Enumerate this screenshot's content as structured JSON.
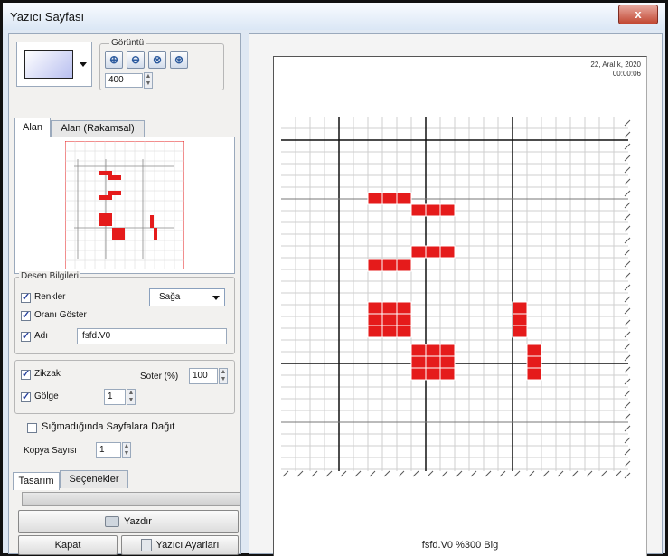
{
  "window": {
    "title": "Yazıcı Sayfası",
    "close_label": "x"
  },
  "view_group": {
    "label": "Görüntü",
    "zoom_value": "400"
  },
  "tabs_top": [
    "Alan",
    "Alan (Rakamsal)"
  ],
  "pattern_info": {
    "label": "Desen Bilgileri",
    "colors_label": "Renkler",
    "colors_checked": true,
    "direction_value": "Sağa",
    "ratio_label": "Oranı Göster",
    "ratio_checked": true,
    "name_label": "Adı",
    "name_checked": true,
    "name_value": "fsfd.V0"
  },
  "options": {
    "zigzag_label": "Zikzak",
    "zigzag_checked": true,
    "soter_label": "Soter (%)",
    "soter_value": "100",
    "shadow_label": "Gölge",
    "shadow_checked": true,
    "shadow_value": "1"
  },
  "fit_pages": {
    "label": "Sığmadığında Sayfalara Dağıt",
    "checked": false
  },
  "copies": {
    "label": "Kopya Sayısı",
    "value": "1"
  },
  "tabs_bottom": [
    "Tasarım",
    "Seçenekler"
  ],
  "buttons": {
    "print": "Yazdır",
    "close": "Kapat",
    "printer_settings": "Yazıcı Ayarları"
  },
  "preview": {
    "date": "22, Aralık, 2020",
    "time": "00:00:06",
    "footer": "fsfd.V0  %300  Big"
  },
  "colors": {
    "accent": "#e51b1b",
    "grid": "#c9c9c9",
    "major_grid": "#111111"
  },
  "icons": [
    "color-swatch-icon",
    "zoom-in-icon",
    "zoom-out-icon",
    "zoom-reset-icon",
    "zoom-fit-icon",
    "printer-icon",
    "printer-settings-icon"
  ]
}
